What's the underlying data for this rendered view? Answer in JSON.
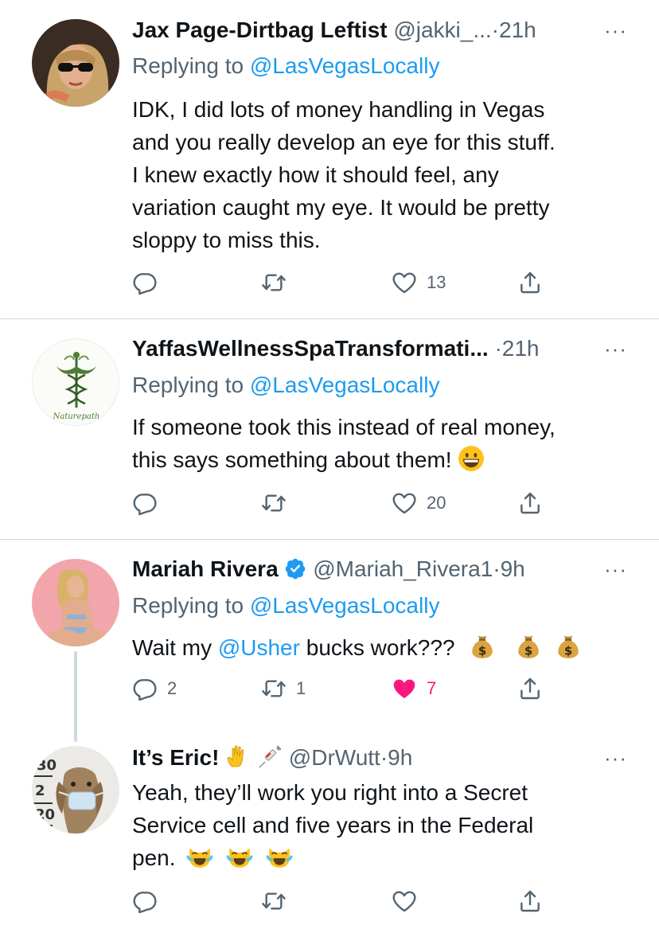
{
  "tweets": [
    {
      "name": "Jax Page-Dirtbag Leftist",
      "handle": "@jakki_...",
      "dot": "·",
      "time": "21h",
      "more": "···",
      "replying_prefix": "Replying to",
      "replying_to": "@LasVegasLocally",
      "lines": [
        "IDK, I did lots of money handling in Vegas",
        "and you really develop an eye for this stuff.",
        "I knew exactly how it should feel, any",
        "variation caught my eye.  It would be pretty",
        "sloppy to miss this."
      ],
      "reply_count": "",
      "retweet_count": "",
      "like_count": "13"
    },
    {
      "name": "YaffasWellnessSpaTransformati...",
      "dot": "·",
      "time": "21h",
      "more": "···",
      "replying_prefix": "Replying to",
      "replying_to": "@LasVegasLocally",
      "line1": "If someone took this instead of real money,",
      "line2": "this says something about them!",
      "like_count": "20",
      "avatar_caption": "Naturepath"
    },
    {
      "name": "Mariah Rivera",
      "handle": "@Mariah_Rivera1",
      "dot": "·",
      "time": "9h",
      "more": "···",
      "replying_prefix": "Replying to",
      "replying_to": "@LasVegasLocally",
      "text_a": "Wait my ",
      "mention": "@Usher",
      "text_b": " bucks work???",
      "reply_count": "2",
      "retweet_count": "1",
      "like_count": "7"
    },
    {
      "name": "It’s Eric!",
      "handle": "@DrWutt",
      "dot": "·",
      "time": "9h",
      "more": "···",
      "line1": "Yeah, they’ll work you right into a Secret",
      "line2": "Service cell and five years in the Federal",
      "line3": "pen.",
      "avatar_marks": [
        "30",
        "2",
        "20"
      ]
    }
  ],
  "icons": {
    "reply": "reply-bubble-icon",
    "retweet": "retweet-icon",
    "like": "heart-icon",
    "share": "share-icon",
    "verified": "verified-badge-icon",
    "emoji_grin": "grinning-face-emoji",
    "emoji_money": "money-bag-emoji",
    "emoji_cat": "cat-tears-of-joy-emoji",
    "emoji_hand": "vulcan-salute-emoji",
    "emoji_syringe": "syringe-emoji"
  },
  "colors": {
    "link": "#1d9bf0",
    "muted": "#536471",
    "like_active": "#f91880",
    "divider": "#cfd9de"
  }
}
